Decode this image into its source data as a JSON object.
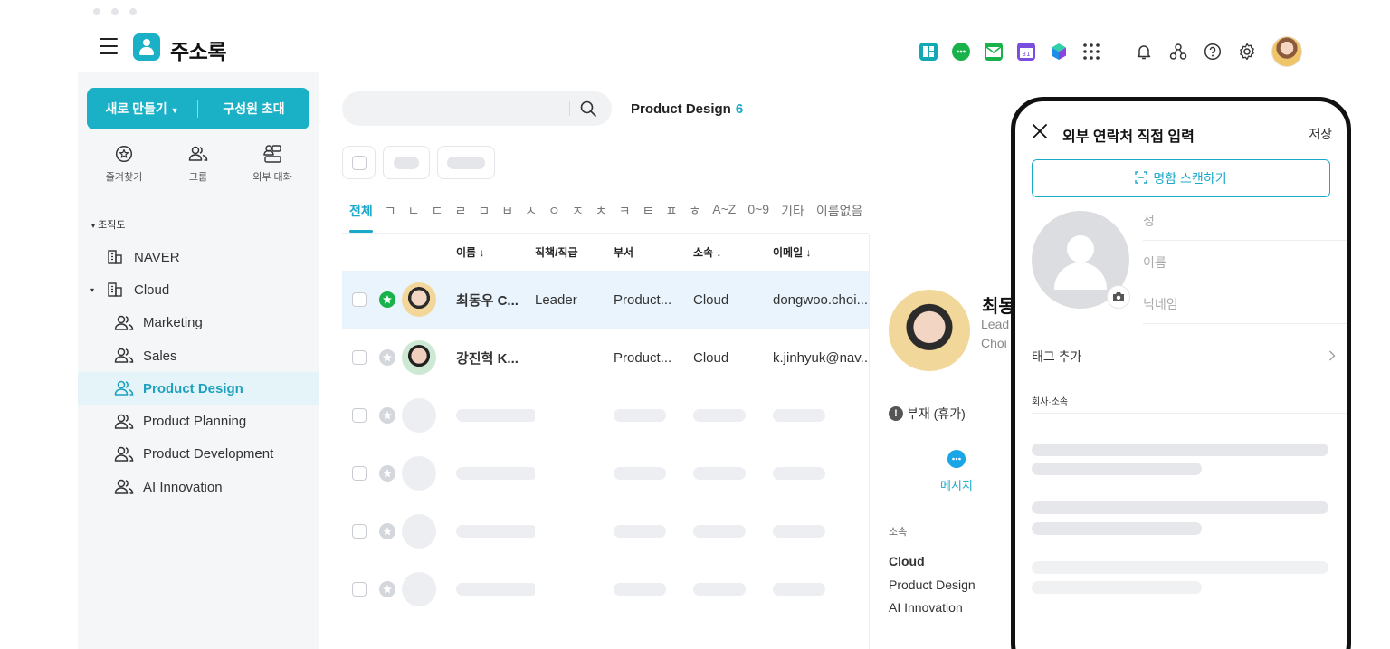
{
  "app": {
    "title": "주소록",
    "header_icons": [
      "dashboard-icon",
      "chat-icon",
      "mail-icon",
      "calendar-icon",
      "drive-icon",
      "apps-grid-icon",
      "bell-icon",
      "org-chart-icon",
      "help-icon",
      "settings-icon",
      "profile-avatar"
    ]
  },
  "colors": {
    "accent": "#1ab0c6",
    "link": "#1aa9c8",
    "favorite": "#19b24a",
    "selected_row": "#e9f4fd"
  },
  "sidebar": {
    "new_label": "새로 만들기",
    "invite_label": "구성원 초대",
    "quick": [
      {
        "label": "즐겨찾기",
        "icon": "star-icon"
      },
      {
        "label": "그룹",
        "icon": "group-icon"
      },
      {
        "label": "외부 대화",
        "icon": "external-chat-icon"
      }
    ],
    "org_label": "조직도",
    "tree": [
      {
        "label": "NAVER",
        "icon": "building-icon"
      },
      {
        "label": "Cloud",
        "icon": "building-icon"
      },
      {
        "label": "Marketing",
        "icon": "group-icon"
      },
      {
        "label": "Sales",
        "icon": "group-icon"
      },
      {
        "label": "Product Design",
        "icon": "group-icon",
        "active": true
      },
      {
        "label": "Product Planning",
        "icon": "group-icon"
      },
      {
        "label": "Product Development",
        "icon": "group-icon"
      },
      {
        "label": "AI Innovation",
        "icon": "group-icon"
      }
    ]
  },
  "main": {
    "search_placeholder": "",
    "breadcrumb": "Product Design",
    "count": "6",
    "index": [
      "전체",
      "ㄱ",
      "ㄴ",
      "ㄷ",
      "ㄹ",
      "ㅁ",
      "ㅂ",
      "ㅅ",
      "ㅇ",
      "ㅈ",
      "ㅊ",
      "ㅋ",
      "ㅌ",
      "ㅍ",
      "ㅎ",
      "A~Z",
      "0~9",
      "기타",
      "이름없음"
    ],
    "columns": {
      "name": "이름 ↓",
      "rank": "직책/직급",
      "dept": "부서",
      "aff": "소속 ↓",
      "email": "이메일 ↓"
    },
    "rows": [
      {
        "name": "최동우 C...",
        "rank": "Leader",
        "dept": "Product...",
        "aff": "Cloud",
        "email": "dongwoo.choi...",
        "favorite": true,
        "selected": true
      },
      {
        "name": "강진혁 K...",
        "rank": "",
        "dept": "Product...",
        "aff": "Cloud",
        "email": "k.jinhyuk@nav...",
        "favorite": false,
        "selected": false
      }
    ]
  },
  "detail": {
    "name": "최동",
    "sub1": "Lead",
    "sub2": "Choi",
    "status": "부재 (휴가)",
    "message_label": "메시지",
    "aff_label": "소속",
    "aff_main": "Cloud",
    "aff_lines": [
      "Product Design",
      "AI Innovation"
    ]
  },
  "phone": {
    "title": "외부 연락처 직접 입력",
    "save_label": "저장",
    "scan_label": "명함 스캔하기",
    "fields": {
      "last_name": "성",
      "first_name": "이름",
      "nickname": "닉네임"
    },
    "tag_label": "태그 추가",
    "section_label": "회사·소속"
  }
}
